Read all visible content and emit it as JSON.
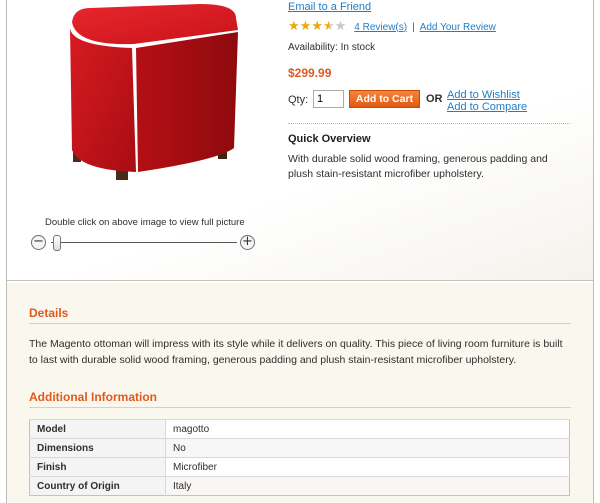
{
  "product": {
    "email_friend": "Email to a Friend",
    "rating": 3.5,
    "rating_max": 5,
    "reviews_link": "4 Review(s)",
    "add_review_link": "Add Your Review",
    "separator": "|",
    "availability": "Availability: In stock",
    "price": "$299.99",
    "qty_label": "Qty:",
    "qty_value": "1",
    "add_to_cart": "Add to Cart",
    "or_label": "OR",
    "wishlist_link": "Add to Wishlist",
    "compare_link": "Add to Compare",
    "quick_overview_title": "Quick Overview",
    "quick_overview_text": "With durable solid wood framing, generous padding and plush stain-resistant microfiber upholstery.",
    "image_color": "#c8141a"
  },
  "zoom": {
    "caption": "Double click on above image to view full picture",
    "zoom_out_symbol": "−",
    "zoom_in_symbol": "+",
    "level": 0
  },
  "details": {
    "title": "Details",
    "text": "The Magento ottoman will impress with its style while it delivers on quality. This piece of living room furniture is built to last with durable solid wood framing, generous padding and plush stain-resistant microfiber upholstery."
  },
  "additional_info": {
    "title": "Additional Information",
    "rows": [
      {
        "label": "Model",
        "value": "magotto"
      },
      {
        "label": "Dimensions",
        "value": "No"
      },
      {
        "label": "Finish",
        "value": "Microfiber"
      },
      {
        "label": "Country of Origin",
        "value": "Italy"
      }
    ]
  },
  "colors": {
    "accent_orange": "#df5a1f",
    "link_blue": "#1e7ec8",
    "star_gold": "#f0a800"
  }
}
